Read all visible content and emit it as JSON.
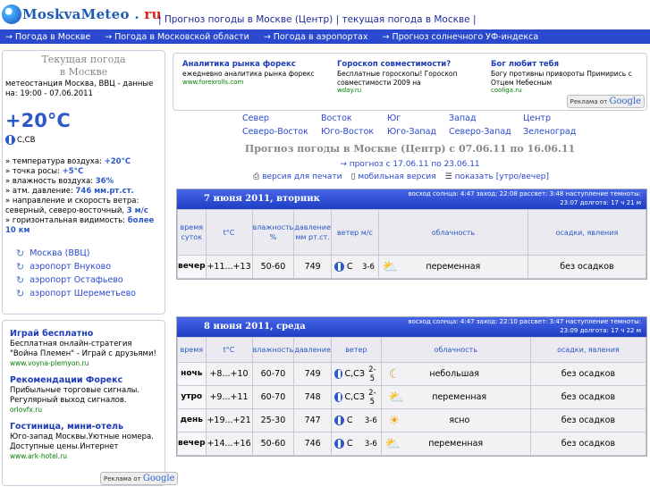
{
  "header": {
    "logo_main": "MoskvaMeteo",
    "logo_dot": " . ",
    "logo_ru": "ru",
    "title": "| Прогноз погоды в Москве (Центр) | текущая погода в Москве |"
  },
  "nav": [
    "→ Погода в Москве",
    "→ Погода в Московской области",
    "→ Погода в аэропортах",
    "→ Прогноз солнечного УФ-индекса"
  ],
  "current": {
    "title1": "Текущая погода",
    "title2": "в Москве",
    "station": "метеостанция Москва, ВВЦ - данные на: 19:00 - 07.06.2011",
    "temp": "+20°C",
    "wind": "С,СВ",
    "params": [
      {
        "label": "» температура воздуха: ",
        "value": "+20°C"
      },
      {
        "label": "» точка росы: ",
        "value": "+5°C"
      },
      {
        "label": "» влажность воздуха: ",
        "value": "36%"
      },
      {
        "label": "» атм. давление: ",
        "value": "746 мм.рт.ст."
      }
    ],
    "wind_dir_line": "» направление и скорость ветра: северный, северо-восточный, ",
    "wind_speed": "3 м/с",
    "visibility_line": "» горизонтальная видимость: ",
    "visibility": "более 10 км",
    "stations": [
      "Москва (ВВЦ)",
      "аэропорт Внуково",
      "аэропорт Остафьево",
      "аэропорт Шереметьево"
    ]
  },
  "left_ads": [
    {
      "h": "Играй бесплатно",
      "t": "Бесплатная онлайн-стратегия \"Война Племен\" - Играй с друзьями!",
      "u": "www.voyna-plemyon.ru"
    },
    {
      "h": "Рекомендации Форекс",
      "t": "Прибыльные торговые сигналы. Регулярный выход сигналов.",
      "u": "orlovfx.ru"
    },
    {
      "h": "Гостиница, мини-отель",
      "t": "Юго-запад Москвы.Уютные номера. Доступные цены.Интернет",
      "u": "www.ark-hotel.ru"
    }
  ],
  "google_label": "Реклама от",
  "google_word": "Google",
  "top_ads": [
    {
      "h": "Аналитика рынка форекс",
      "t": "ежедневно аналитика рынка форекс",
      "u": "www.forexrolls.com"
    },
    {
      "h": "Гороскоп совместимости?",
      "t": "Бесплатные гороскопы! Гороскоп совместимости 2009 на",
      "u": "wday.ru"
    },
    {
      "h": "Бог любит тебя",
      "t": "Богу противны привороты Примирись с Отцем Небесным",
      "u": "cooliga.ru"
    }
  ],
  "regions": {
    "row1": [
      "Север",
      "Восток",
      "Юг",
      "Запад",
      "Центр"
    ],
    "row2": [
      "Северо-Восток",
      "Юго-Восток",
      "Юго-Запад",
      "Северо-Запад",
      "Зеленоград"
    ]
  },
  "forecast": {
    "title": "Прогноз погоды в Москве (Центр) с 07.06.11 по 16.06.11",
    "next_link": "→ прогноз с 17.06.11 по 23.06.11",
    "print": "версия для печати",
    "mobile": "мобильная версия",
    "show": "показать [утро/вечер]"
  },
  "day1": {
    "date": "7 июня 2011, вторник",
    "sun1": "восход солнца: 4:47   заход: 22:08   рассвет: 3:48   наступление темноты:",
    "sun2": "23:07   долгота: 17 ч 21 м",
    "headers": [
      "время суток",
      "t°C",
      "влажность %",
      "давление мм рт.ст.",
      "ветер м/с",
      "облачность",
      "осадки, явления"
    ],
    "rows": [
      {
        "tod": "вечер",
        "t": "+11...+13",
        "hum": "50-60",
        "p": "749",
        "wd": "С",
        "ws": "3-6",
        "cloud": "переменная",
        "prec": "без осадков",
        "icon": "⛅"
      }
    ]
  },
  "day2": {
    "date": "8 июня 2011, среда",
    "sun1": "восход солнца: 4:47   заход: 22:10   рассвет: 3:47   наступление темноты:",
    "sun2": "23:09   долгота: 17 ч 22 м",
    "headers": [
      "время",
      "t°C",
      "влажность",
      "давление",
      "ветер",
      "облачность",
      "осадки, явления"
    ],
    "rows": [
      {
        "tod": "ночь",
        "t": "+8...+10",
        "hum": "60-70",
        "p": "749",
        "wd": "С,СЗ",
        "ws": "2-5",
        "cloud": "небольшая",
        "prec": "без осадков",
        "icon": "☾"
      },
      {
        "tod": "утро",
        "t": "+9...+11",
        "hum": "60-70",
        "p": "748",
        "wd": "С,СЗ",
        "ws": "2-5",
        "cloud": "переменная",
        "prec": "без осадков",
        "icon": "⛅"
      },
      {
        "tod": "день",
        "t": "+19...+21",
        "hum": "25-30",
        "p": "747",
        "wd": "С",
        "ws": "3-6",
        "cloud": "ясно",
        "prec": "без осадков",
        "icon": "☀"
      },
      {
        "tod": "вечер",
        "t": "+14...+16",
        "hum": "50-60",
        "p": "746",
        "wd": "С",
        "ws": "3-6",
        "cloud": "переменная",
        "prec": "без осадков",
        "icon": "⛅"
      }
    ]
  }
}
